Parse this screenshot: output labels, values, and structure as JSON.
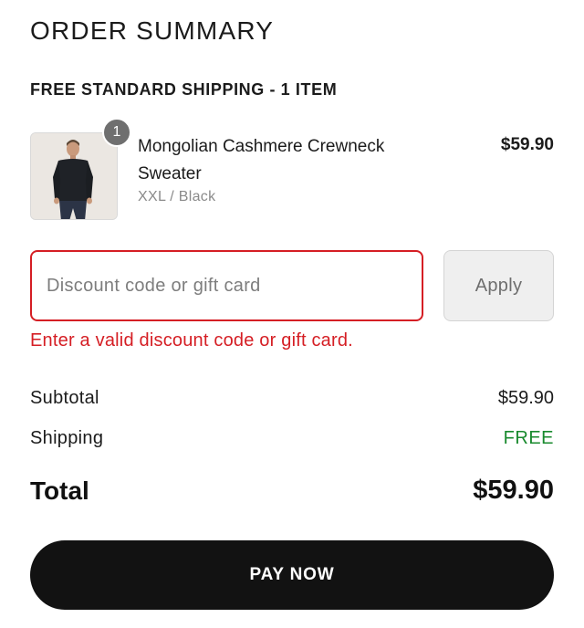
{
  "header": {
    "title": "ORDER SUMMARY"
  },
  "shipping_section": {
    "title": "FREE STANDARD SHIPPING - 1 ITEM"
  },
  "item": {
    "quantity": "1",
    "name": "Mongolian Cashmere Crewneck Sweater",
    "variant": "XXL / Black",
    "price": "$59.90",
    "image_icon": "product-photo-sweater"
  },
  "discount": {
    "placeholder": "Discount code or gift card",
    "value": "",
    "apply_label": "Apply",
    "error": "Enter a valid discount code or gift card."
  },
  "totals": {
    "subtotal_label": "Subtotal",
    "subtotal_value": "$59.90",
    "shipping_label": "Shipping",
    "shipping_value": "FREE",
    "total_label": "Total",
    "total_value": "$59.90"
  },
  "actions": {
    "pay_label": "PAY NOW"
  },
  "colors": {
    "error": "#d51e24",
    "free": "#198a2e",
    "primary_button": "#121212"
  }
}
